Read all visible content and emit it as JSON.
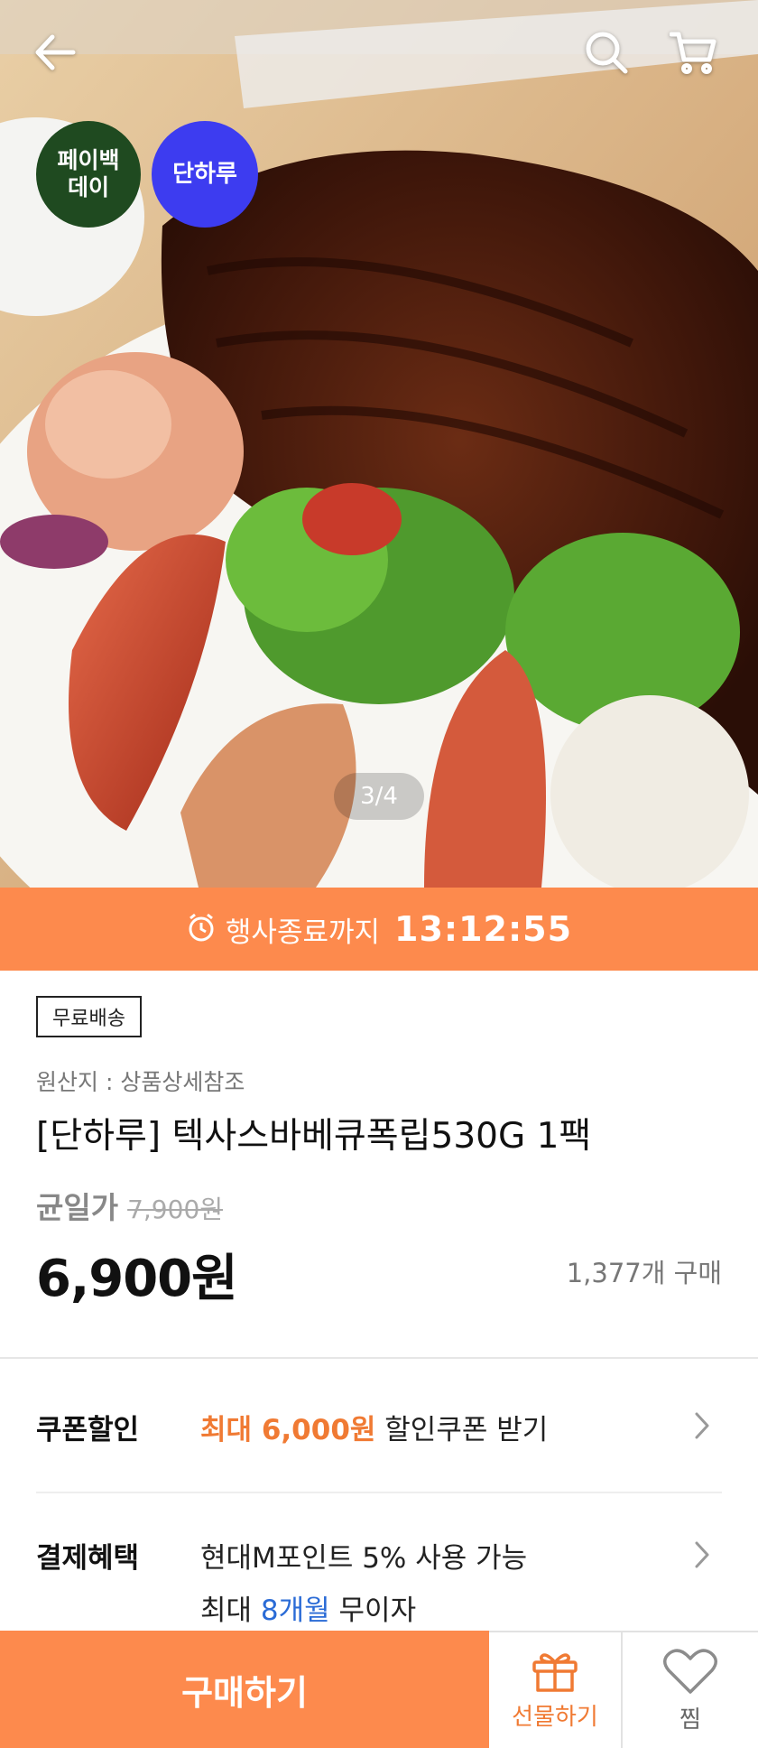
{
  "header": {
    "back_icon": "arrow-left-icon",
    "search_icon": "search-icon",
    "cart_icon": "cart-icon"
  },
  "badges": [
    {
      "label": "페이백\n데이",
      "color": "#1f4a20"
    },
    {
      "label": "단하루",
      "color": "#3d3cf0"
    }
  ],
  "gallery": {
    "indicator": "3/4"
  },
  "countdown": {
    "label": "행사종료까지",
    "time": "13:12:55",
    "color": "#fd8a4d"
  },
  "product": {
    "shipping_tag": "무료배송",
    "origin": "원산지 : 상품상세참조",
    "title": "[단하루] 텍사스바베큐폭립530G 1팩",
    "original_label": "균일가",
    "original_price": "7,900원",
    "price": "6,900원",
    "sold_count": "1,377개 구매"
  },
  "coupon": {
    "label": "쿠폰할인",
    "highlight": "최대 6,000원",
    "text": "할인쿠폰 받기"
  },
  "payment": {
    "label": "결제혜택",
    "line1": "현대M포인트 5% 사용 가능",
    "line2_prefix": "최대",
    "line2_highlight": "8개월",
    "line2_suffix": "무이자"
  },
  "bottom_bar": {
    "buy_label": "구매하기",
    "gift_label": "선물하기",
    "wish_label": "찜",
    "accent": "#fd8a4d"
  }
}
